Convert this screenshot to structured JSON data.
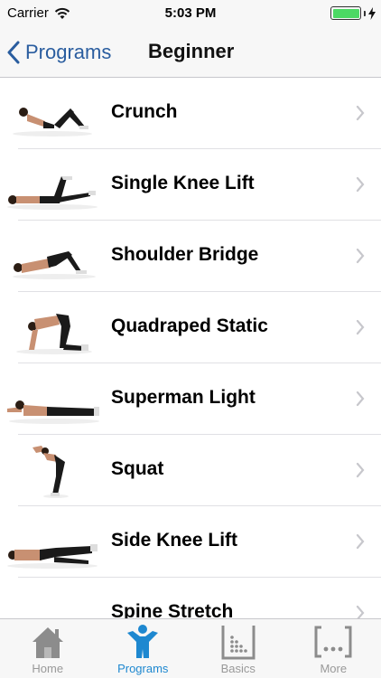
{
  "status_bar": {
    "carrier": "Carrier",
    "time": "5:03 PM",
    "battery_level": 1.0,
    "battery_color": "#4cd964"
  },
  "nav": {
    "back_label": "Programs",
    "title": "Beginner",
    "accent_color": "#2a5d9f"
  },
  "exercises": [
    {
      "label": "Crunch"
    },
    {
      "label": "Single Knee Lift"
    },
    {
      "label": "Shoulder Bridge"
    },
    {
      "label": "Quadraped Static"
    },
    {
      "label": "Superman Light"
    },
    {
      "label": "Squat"
    },
    {
      "label": "Side Knee Lift"
    },
    {
      "label": "Spine Stretch"
    }
  ],
  "tabs": [
    {
      "label": "Home",
      "icon": "home-icon",
      "active": false
    },
    {
      "label": "Programs",
      "icon": "person-icon",
      "active": true
    },
    {
      "label": "Basics",
      "icon": "dots-box-icon",
      "active": false
    },
    {
      "label": "More",
      "icon": "ellipsis-bracket-icon",
      "active": false
    }
  ]
}
